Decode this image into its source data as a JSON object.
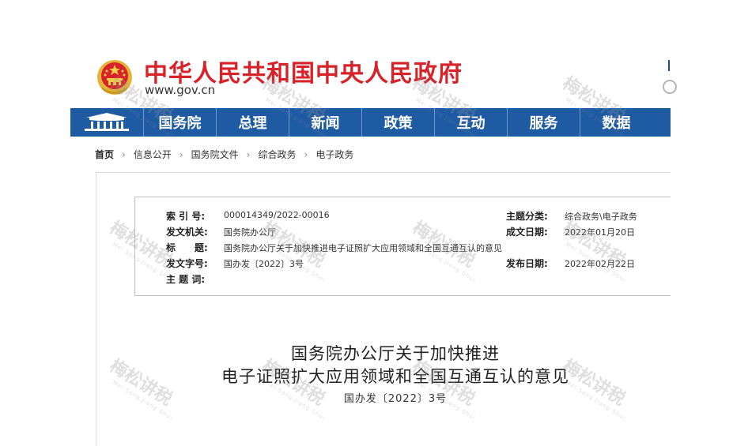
{
  "header": {
    "site_title": "中华人民共和国中央人民政府",
    "site_url": "www.gov.cn",
    "emblem_icon": "national-emblem-icon"
  },
  "nav": {
    "items": [
      {
        "label": "国务院"
      },
      {
        "label": "总理"
      },
      {
        "label": "新闻"
      },
      {
        "label": "政策"
      },
      {
        "label": "互动"
      },
      {
        "label": "服务"
      },
      {
        "label": "数据"
      }
    ]
  },
  "breadcrumb": {
    "items": [
      "首页",
      "信息公开",
      "国务院文件",
      "综合政务",
      "电子政务"
    ]
  },
  "metadata": {
    "index_label": "索 引 号:",
    "index_value": "000014349/2022-00016",
    "topic_label": "主题分类:",
    "topic_value": "综合政务\\电子政务",
    "issuer_label": "发文机关:",
    "issuer_value": "国务院办公厅",
    "written_label": "成文日期:",
    "written_value": "2022年01月20日",
    "title_label": "标　　题:",
    "title_value": "国务院办公厅关于加快推进电子证照扩大应用领域和全国互通互认的意见",
    "docno_label": "发文字号:",
    "docno_value": "国办发〔2022〕3号",
    "published_label": "发布日期:",
    "published_value": "2022年02月22日",
    "subject_label": "主 题 词:",
    "subject_value": ""
  },
  "document": {
    "title_line1": "国务院办公厅关于加快推进",
    "title_line2": "电子证照扩大应用领域和全国互通互认的意见",
    "number": "国办发〔2022〕3号"
  },
  "watermark": {
    "text": "梅松讲税",
    "subtext": "Mei Song Jiang Shui"
  },
  "colors": {
    "brand_red": "#d6232a",
    "nav_blue": "#1f5ba3"
  }
}
